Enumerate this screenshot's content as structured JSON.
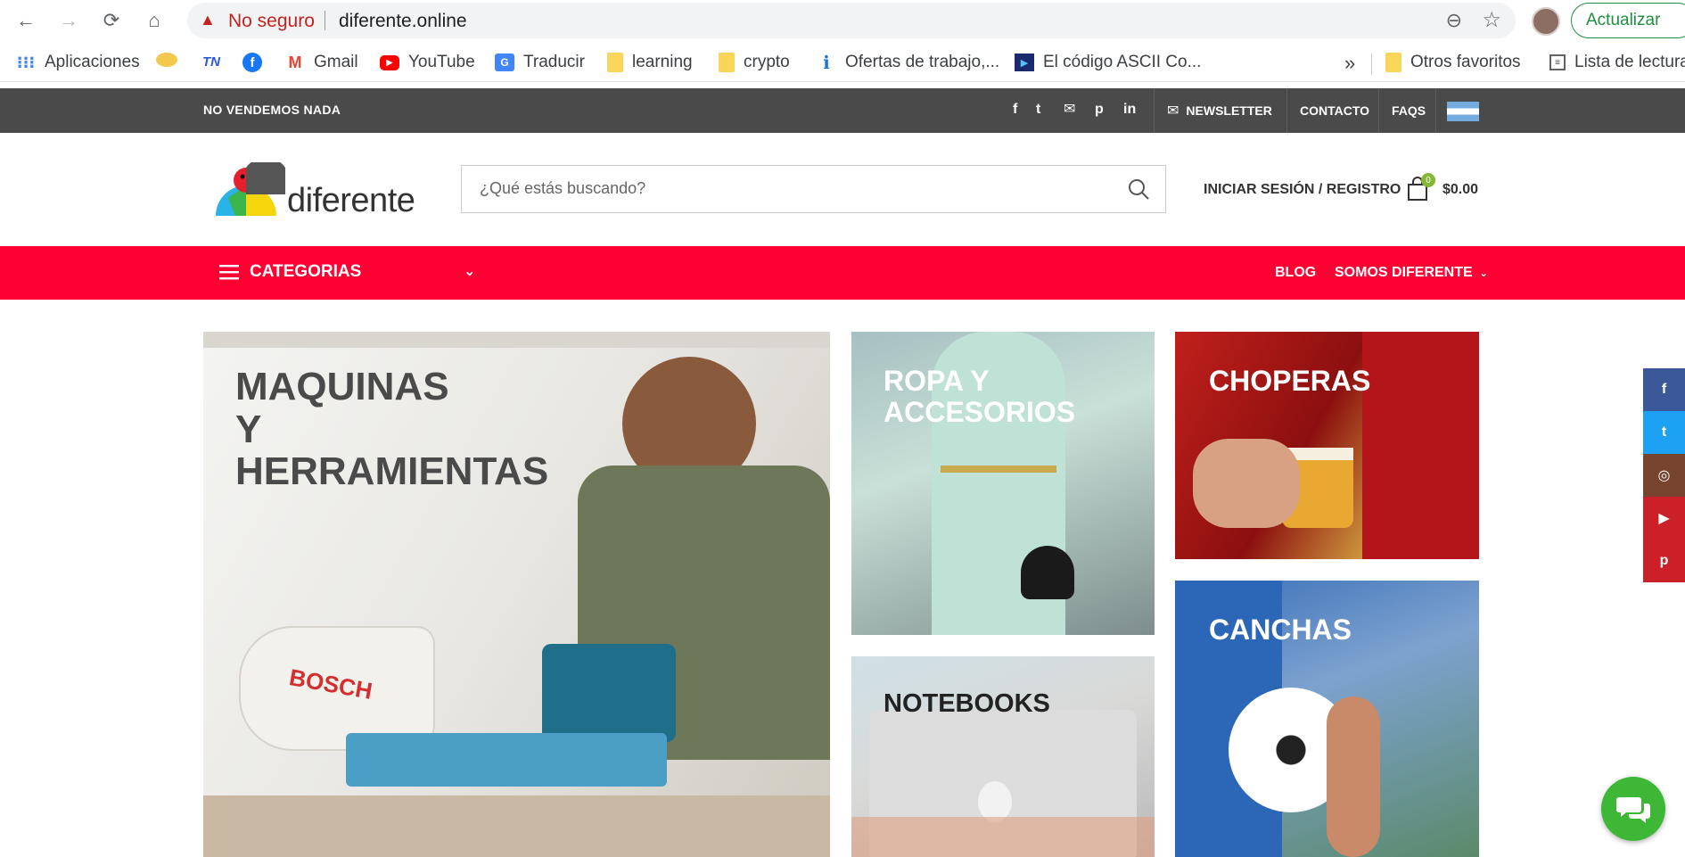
{
  "browser": {
    "security_label": "No seguro",
    "url": "diferente.online",
    "update_label": "Actualizar",
    "bookmarks": [
      {
        "label": "Aplicaciones",
        "icon": "apps-grid-icon"
      },
      {
        "label": "",
        "icon": "sombrero-icon"
      },
      {
        "label": "",
        "icon": "tn-icon"
      },
      {
        "label": "",
        "icon": "facebook-icon"
      },
      {
        "label": "Gmail",
        "icon": "gmail-icon"
      },
      {
        "label": "YouTube",
        "icon": "youtube-icon"
      },
      {
        "label": "Traducir",
        "icon": "translate-icon"
      },
      {
        "label": "learning",
        "icon": "folder-icon"
      },
      {
        "label": "crypto",
        "icon": "folder-icon"
      },
      {
        "label": "Ofertas de trabajo,...",
        "icon": "job-icon"
      },
      {
        "label": "El código ASCII Co...",
        "icon": "ascii-icon"
      }
    ],
    "more_label": "»",
    "other_favorites": "Otros favoritos",
    "reading_list": "Lista de lectura"
  },
  "topbar": {
    "tagline": "NO VENDEMOS NADA",
    "social": [
      "f",
      "t",
      "m",
      "p",
      "in"
    ],
    "newsletter": "NEWSLETTER",
    "contact": "CONTACTO",
    "faqs": "FAQS"
  },
  "header": {
    "logo_text": "diferente",
    "search_placeholder": "¿Qué estás buscando?",
    "login": "INICIAR SESIÓN / REGISTRO",
    "cart_count": "0",
    "cart_total": "$0.00"
  },
  "menu": {
    "categories": "CATEGORIAS",
    "blog": "BLOG",
    "somos": "SOMOS DIFERENTE"
  },
  "tiles": {
    "machines": "MAQUINAS\nY\nHERRAMIENTAS",
    "ropa": "ROPA Y\nACCESORIOS",
    "choperas": "CHOPERAS",
    "notebooks": "NOTEBOOKS",
    "canchas": "CANCHAS",
    "bosch": "BOSCH"
  },
  "side_social": [
    {
      "icon": "facebook-icon",
      "glyph": "f",
      "color": "#3b5998"
    },
    {
      "icon": "twitter-icon",
      "glyph": "t",
      "color": "#1da1f2"
    },
    {
      "icon": "instagram-icon",
      "glyph": "◎",
      "color": "#774430"
    },
    {
      "icon": "youtube-icon",
      "glyph": "▶",
      "color": "#cb2027"
    },
    {
      "icon": "pinterest-icon",
      "glyph": "p",
      "color": "#cb2027"
    }
  ],
  "colors": {
    "topbar": "#4a4a4a",
    "menu_red": "#ff0033",
    "accent_green": "#83b735",
    "chat_green": "#3db735"
  }
}
